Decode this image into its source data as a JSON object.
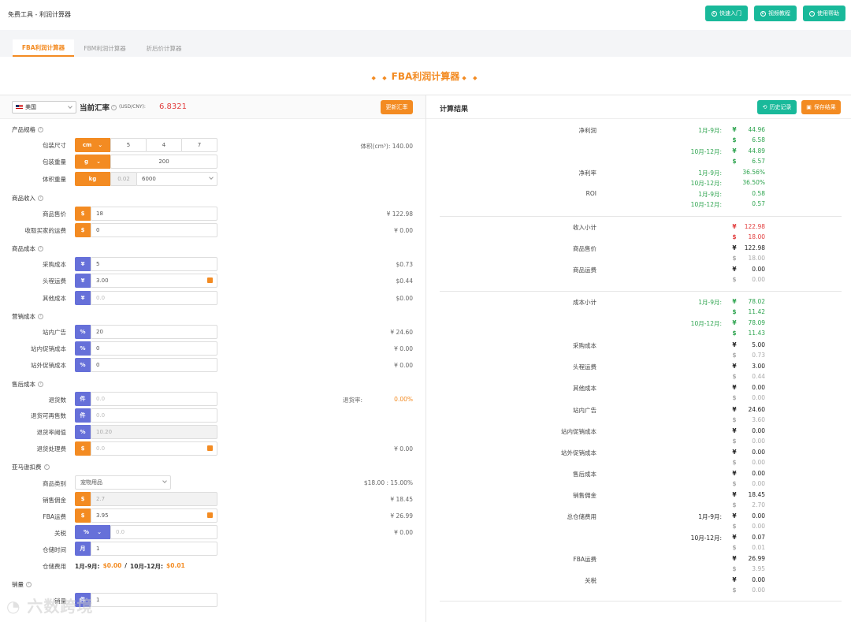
{
  "breadcrumb": "免费工具 - 利润计算器",
  "top_buttons": {
    "quick": "快速入门",
    "video": "视频教程",
    "help": "使用帮助"
  },
  "tabs": [
    "FBA利润计算器",
    "FBM利润计算器",
    "折后价计算器"
  ],
  "page_title": "FBA利润计算器",
  "header": {
    "country": "美国",
    "rate_label": "当前汇率",
    "rate_unit": "(USD/CNY):",
    "rate_value": "6.8321",
    "update_btn": "更新汇率"
  },
  "result": {
    "title": "计算结果",
    "history_btn": "历史记录",
    "save_btn": "保存结果"
  },
  "sections": {
    "spec": "产品规格",
    "income": "商品收入",
    "cost": "商品成本",
    "marketing": "营销成本",
    "aftersale": "售后成本",
    "amazon": "亚马逊扣费",
    "sales": "销量"
  },
  "spec": {
    "size_label": "包装尺寸",
    "size_unit": "cm",
    "l": "5",
    "w": "4",
    "h": "7",
    "weight_label": "包装重量",
    "weight_unit": "g",
    "weight": "200",
    "vol_label": "体积重量",
    "vol_unit": "kg",
    "vol_ro": "0.02",
    "vol_div": "6000",
    "vol_info": "体积(cm³): 140.00"
  },
  "income": {
    "price_label": "商品售价",
    "price": "18",
    "price_val": "¥ 122.98",
    "ship_label": "收取买家的运费",
    "ship": "0",
    "ship_val": "¥ 0.00"
  },
  "cost": {
    "purchase_label": "采购成本",
    "purchase": "5",
    "purchase_val": "$0.73",
    "head_label": "头程运费",
    "head": "3.00",
    "head_val": "$0.44",
    "other_label": "其他成本",
    "other": "0.0",
    "other_val": "$0.00"
  },
  "marketing": {
    "ad_label": "站内广告",
    "ad": "20",
    "ad_val": "¥ 24.60",
    "promo_label": "站内促销成本",
    "promo": "0",
    "promo_val": "¥ 0.00",
    "outpromo_label": "站外促销成本",
    "outpromo": "0",
    "outpromo_val": "¥ 0.00"
  },
  "aftersale": {
    "returns_label": "退货数",
    "returns": "0.0",
    "return_rate_label": "退货率:",
    "return_rate": "0.00%",
    "resell_label": "退货可再售数",
    "resell": "0.0",
    "threshold_label": "退货率阈值",
    "threshold": "10.20",
    "handle_label": "退货处理费",
    "handle": "0.0",
    "handle_val": "¥ 0.00"
  },
  "amazon": {
    "category_label": "商品类别",
    "category": "宠物用品",
    "category_val": "$18.00 : 15.00%",
    "commission_label": "销售佣金",
    "commission": "2.7",
    "commission_val": "¥ 18.45",
    "fba_label": "FBA运费",
    "fba": "3.95",
    "fba_val": "¥ 26.99",
    "tax_label": "关税",
    "tax_unit": "%",
    "tax": "0.0",
    "tax_val": "¥ 0.00",
    "storage_time_label": "仓储时间",
    "storage_time_unit": "月",
    "storage_time": "1",
    "storage_fee_label": "仓储费用",
    "storage_fee_p1": "1月-9月:",
    "storage_fee_v1": "$0.00",
    "storage_fee_sep": "/",
    "storage_fee_p2": "10月-12月:",
    "storage_fee_v2": "$0.01"
  },
  "sales": {
    "label": "销量",
    "unit": "件",
    "value": "1"
  },
  "prefixes": {
    "dollar": "$",
    "yuan": "¥",
    "pct": "%",
    "piece": "件"
  },
  "results": {
    "net_profit": "净利润",
    "p1": "1月-9月:",
    "p2": "10月-12月:",
    "np1y": "44.96",
    "np1d": "6.58",
    "np2y": "44.89",
    "np2d": "6.57",
    "net_margin": "净利率",
    "nm1": "36.56%",
    "nm2": "36.50%",
    "roi": "ROI",
    "roi1": "0.58",
    "roi2": "0.57",
    "income_sub": "收入小计",
    "is_y": "122.98",
    "is_d": "18.00",
    "price": "商品售价",
    "pr_y": "122.98",
    "pr_d": "18.00",
    "ship": "商品运费",
    "sh_y": "0.00",
    "sh_d": "0.00",
    "cost_sub": "成本小计",
    "cs1y": "78.02",
    "cs1d": "11.42",
    "cs2y": "78.09",
    "cs2d": "11.43",
    "rows": [
      {
        "label": "采购成本",
        "y": "5.00",
        "d": "0.73"
      },
      {
        "label": "头程运费",
        "y": "3.00",
        "d": "0.44"
      },
      {
        "label": "其他成本",
        "y": "0.00",
        "d": "0.00"
      },
      {
        "label": "站内广告",
        "y": "24.60",
        "d": "3.60"
      },
      {
        "label": "站内促销成本",
        "y": "0.00",
        "d": "0.00"
      },
      {
        "label": "站外促销成本",
        "y": "0.00",
        "d": "0.00"
      },
      {
        "label": "售后成本",
        "y": "0.00",
        "d": "0.00"
      },
      {
        "label": "销售佣金",
        "y": "18.45",
        "d": "2.70"
      }
    ],
    "storage": "总仓储费用",
    "st1y": "0.00",
    "st1d": "0.00",
    "st2y": "0.07",
    "st2d": "0.01",
    "fba": "FBA运费",
    "fba_y": "26.99",
    "fba_d": "3.95",
    "tax": "关税",
    "tax_y": "0.00",
    "tax_d": "0.00"
  },
  "watermark": "六数跨境"
}
